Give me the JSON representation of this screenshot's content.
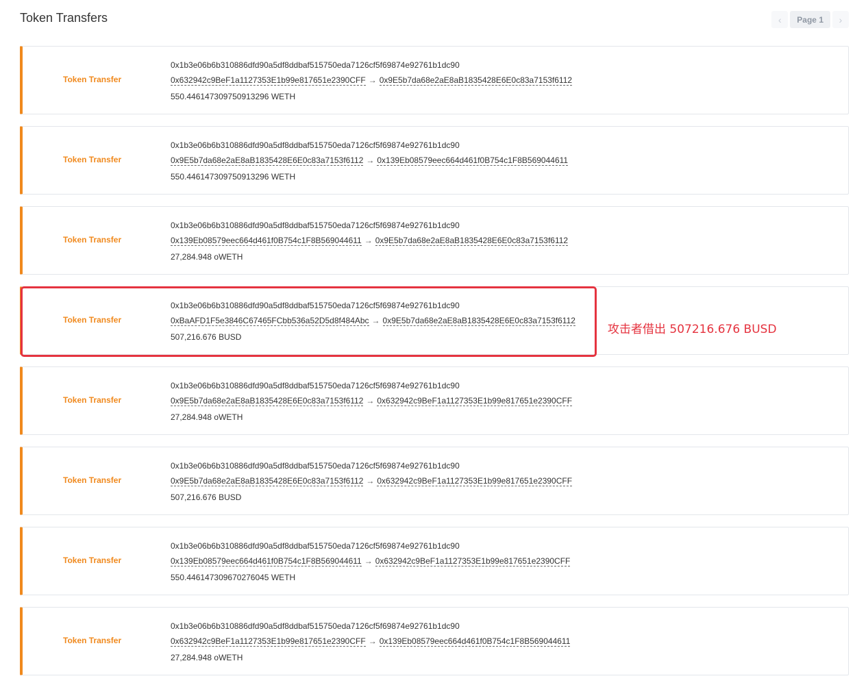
{
  "header": {
    "title": "Token Transfers",
    "pager": {
      "prev_icon": "chevron-left-icon",
      "page_label": "Page 1",
      "next_icon": "chevron-right-icon"
    }
  },
  "transfers": [
    {
      "tag": "Token Transfer",
      "hash": "0x1b3e06b6b310886dfd90a5df8ddbaf515750eda7126cf5f69874e92761b1dc90",
      "from": "0x632942c9BeF1a1127353E1b99e817651e2390CFF",
      "to": "0x9E5b7da68e2aE8aB1835428E6E0c83a7153f6112",
      "amount": "550.446147309750913296 WETH"
    },
    {
      "tag": "Token Transfer",
      "hash": "0x1b3e06b6b310886dfd90a5df8ddbaf515750eda7126cf5f69874e92761b1dc90",
      "from": "0x9E5b7da68e2aE8aB1835428E6E0c83a7153f6112",
      "to": "0x139Eb08579eec664d461f0B754c1F8B569044611",
      "amount": "550.446147309750913296 WETH"
    },
    {
      "tag": "Token Transfer",
      "hash": "0x1b3e06b6b310886dfd90a5df8ddbaf515750eda7126cf5f69874e92761b1dc90",
      "from": "0x139Eb08579eec664d461f0B754c1F8B569044611",
      "to": "0x9E5b7da68e2aE8aB1835428E6E0c83a7153f6112",
      "amount": "27,284.948 oWETH"
    },
    {
      "tag": "Token Transfer",
      "hash": "0x1b3e06b6b310886dfd90a5df8ddbaf515750eda7126cf5f69874e92761b1dc90",
      "from": "0xBaAFD1F5e3846C67465FCbb536a52D5d8f484Abc",
      "to": "0x9E5b7da68e2aE8aB1835428E6E0c83a7153f6112",
      "amount": "507,216.676 BUSD"
    },
    {
      "tag": "Token Transfer",
      "hash": "0x1b3e06b6b310886dfd90a5df8ddbaf515750eda7126cf5f69874e92761b1dc90",
      "from": "0x9E5b7da68e2aE8aB1835428E6E0c83a7153f6112",
      "to": "0x632942c9BeF1a1127353E1b99e817651e2390CFF",
      "amount": "27,284.948 oWETH"
    },
    {
      "tag": "Token Transfer",
      "hash": "0x1b3e06b6b310886dfd90a5df8ddbaf515750eda7126cf5f69874e92761b1dc90",
      "from": "0x9E5b7da68e2aE8aB1835428E6E0c83a7153f6112",
      "to": "0x632942c9BeF1a1127353E1b99e817651e2390CFF",
      "amount": "507,216.676 BUSD"
    },
    {
      "tag": "Token Transfer",
      "hash": "0x1b3e06b6b310886dfd90a5df8ddbaf515750eda7126cf5f69874e92761b1dc90",
      "from": "0x139Eb08579eec664d461f0B754c1F8B569044611",
      "to": "0x632942c9BeF1a1127353E1b99e817651e2390CFF",
      "amount": "550.446147309670276045 WETH"
    },
    {
      "tag": "Token Transfer",
      "hash": "0x1b3e06b6b310886dfd90a5df8ddbaf515750eda7126cf5f69874e92761b1dc90",
      "from": "0x632942c9BeF1a1127353E1b99e817651e2390CFF",
      "to": "0x139Eb08579eec664d461f0B754c1F8B569044611",
      "amount": "27,284.948 oWETH"
    }
  ],
  "arrow_glyph": "→",
  "annotation": {
    "text": "攻击者借出 507216.676 BUSD",
    "color": "#e5333f"
  },
  "colors": {
    "accent": "#f0891d",
    "highlight": "#e5333f"
  }
}
